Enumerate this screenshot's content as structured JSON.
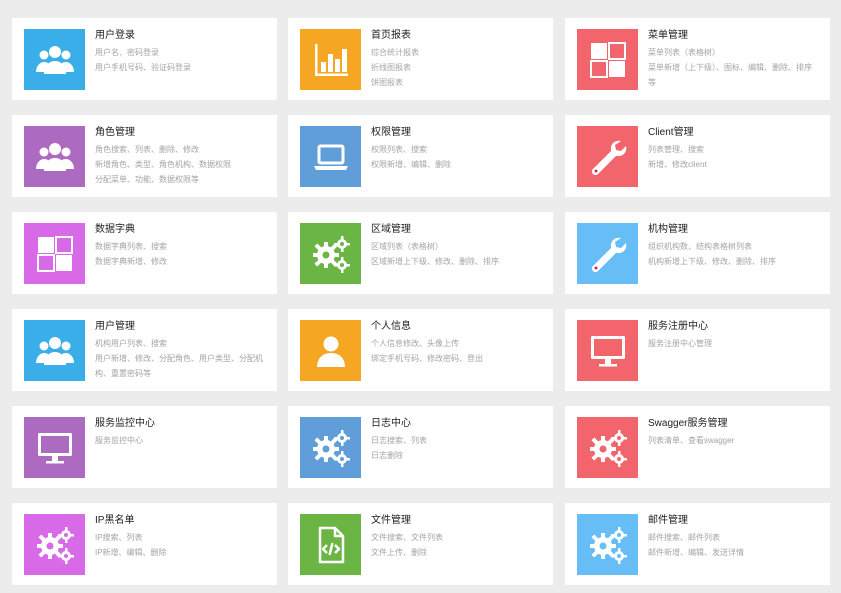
{
  "colors": {
    "blue": "#3aaee8",
    "orange": "#f5a623",
    "red": "#f3656d",
    "purple": "#ac6ac0",
    "steel": "#5f9ed9",
    "magenta": "#d86ae8",
    "green": "#6bb544",
    "sky": "#67bdf6"
  },
  "cards": [
    {
      "title": "用户登录",
      "icon": "users-icon",
      "color": "#3aaee8",
      "desc": [
        "用户名、密码登录",
        "用户手机号码、验证码登录"
      ]
    },
    {
      "title": "首页报表",
      "icon": "bar-chart-icon",
      "color": "#f5a623",
      "desc": [
        "综合统计报表",
        "折线图报表",
        "饼图报表"
      ]
    },
    {
      "title": "菜单管理",
      "icon": "grid-icon",
      "color": "#f3656d",
      "desc": [
        "菜单列表（表格树）",
        "菜单新增（上下级）、图标、编辑、删除、排序等"
      ]
    },
    {
      "title": "角色管理",
      "icon": "users-icon",
      "color": "#ac6ac0",
      "desc": [
        "角色搜索、列表、删除、修改",
        "新增角色、类型、角色机构、数据权限",
        "分配菜单、功能、数据权限等"
      ]
    },
    {
      "title": "权限管理",
      "icon": "laptop-icon",
      "color": "#5f9ed9",
      "desc": [
        "权限列表、搜索",
        "权限新增、编辑、删除"
      ]
    },
    {
      "title": "Client管理",
      "icon": "wrench-icon",
      "color": "#f3656d",
      "desc": [
        "列表管理、搜索",
        "新增、修改client"
      ]
    },
    {
      "title": "数据字典",
      "icon": "grid-icon",
      "color": "#d86ae8",
      "desc": [
        "数据字典列表、搜索",
        "数据字典新增、修改"
      ]
    },
    {
      "title": "区域管理",
      "icon": "gears-icon",
      "color": "#6bb544",
      "desc": [
        "区域列表（表格树）",
        "区域新增上下级、修改、删除、排序"
      ]
    },
    {
      "title": "机构管理",
      "icon": "wrench-icon",
      "color": "#67bdf6",
      "desc": [
        "组织机构数、结构表格树列表",
        "机构新增上下级、修改、删除、排序"
      ]
    },
    {
      "title": "用户管理",
      "icon": "users-icon",
      "color": "#3aaee8",
      "desc": [
        "机构用户列表、搜索",
        "用户新增、修改、分配角色、用户类型、分配机构、重置密码等"
      ]
    },
    {
      "title": "个人信息",
      "icon": "user-icon",
      "color": "#f5a623",
      "desc": [
        "个人信息修改、头像上传",
        "绑定手机号码、修改密码、登出"
      ]
    },
    {
      "title": "服务注册中心",
      "icon": "monitor-icon",
      "color": "#f3656d",
      "desc": [
        "服务注册中心管理"
      ]
    },
    {
      "title": "服务监控中心",
      "icon": "monitor-icon",
      "color": "#ac6ac0",
      "desc": [
        "服务监控中心"
      ]
    },
    {
      "title": "日志中心",
      "icon": "gears-icon",
      "color": "#5f9ed9",
      "desc": [
        "日志搜索、列表",
        "日志删除"
      ]
    },
    {
      "title": "Swagger服务管理",
      "icon": "gears-icon",
      "color": "#f3656d",
      "desc": [
        "列表清单、查看swagger"
      ]
    },
    {
      "title": "IP黑名单",
      "icon": "gears-icon",
      "color": "#d86ae8",
      "desc": [
        "IP搜索、列表",
        "IP新增、编辑、删除"
      ]
    },
    {
      "title": "文件管理",
      "icon": "code-file-icon",
      "color": "#6bb544",
      "desc": [
        "文件搜索、文件列表",
        "文件上传、删除"
      ]
    },
    {
      "title": "邮件管理",
      "icon": "gears-icon",
      "color": "#67bdf6",
      "desc": [
        "邮件搜索、邮件列表",
        "邮件新增、编辑、发送详情"
      ]
    }
  ]
}
